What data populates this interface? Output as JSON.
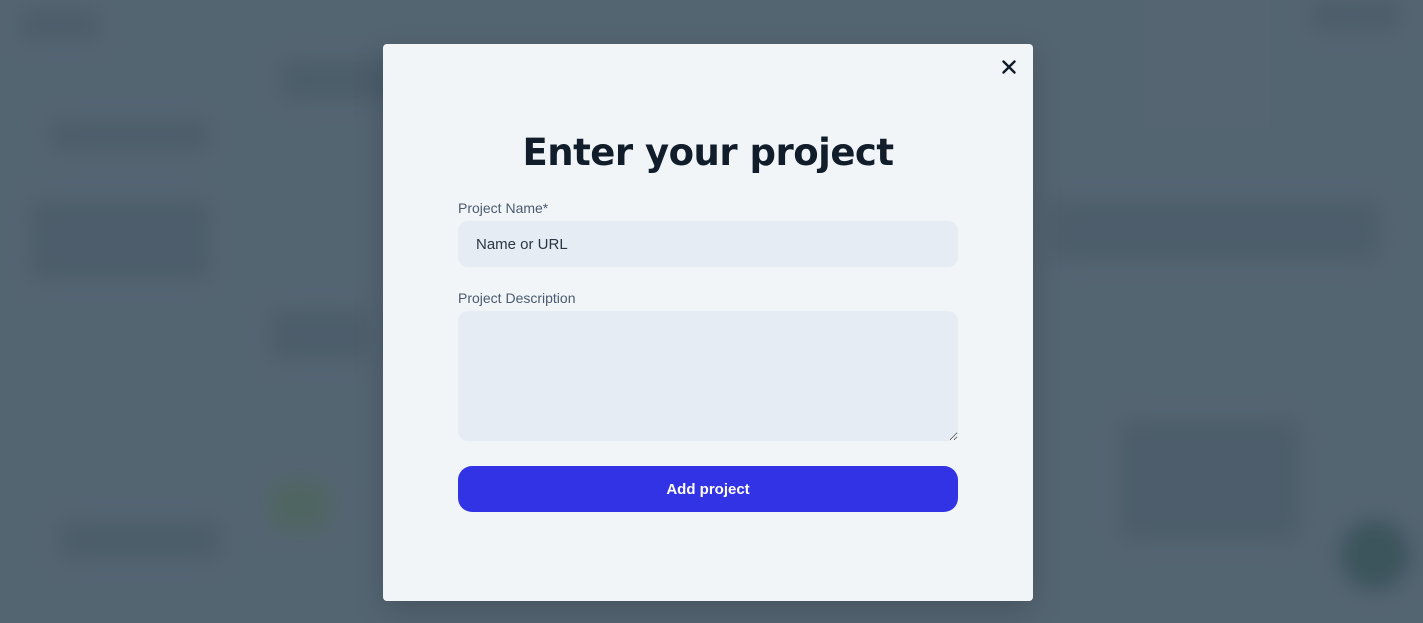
{
  "modal": {
    "title": "Enter your project",
    "close_icon": "close-icon",
    "project_name": {
      "label": "Project Name*",
      "value": "",
      "placeholder": "Name or URL"
    },
    "project_description": {
      "label": "Project Description",
      "value": "",
      "placeholder": ""
    },
    "submit_label": "Add project"
  },
  "colors": {
    "accent": "#3333e6",
    "modal_bg": "#f1f5f8",
    "input_bg": "#e5ecf3",
    "title": "#111d2b"
  }
}
